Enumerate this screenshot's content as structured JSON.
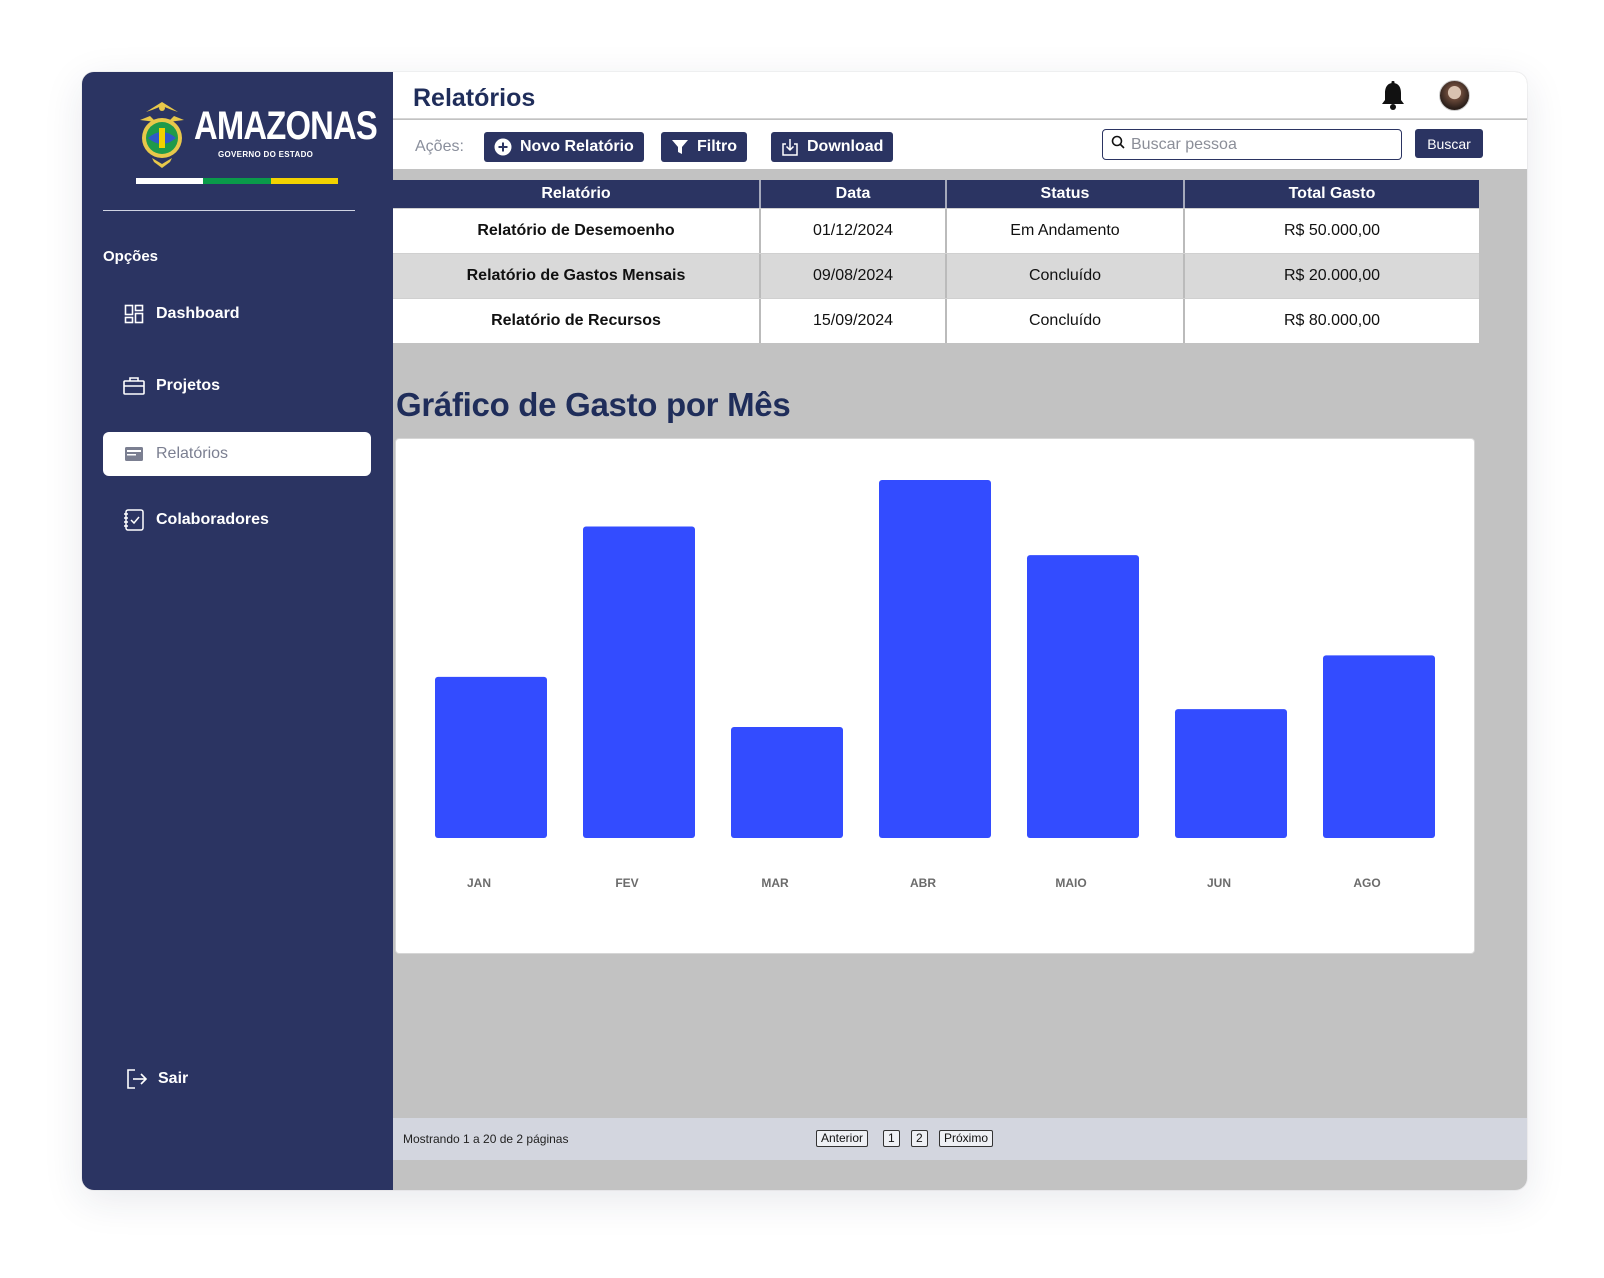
{
  "brand": {
    "title": "AMAZONAS",
    "subtitle": "GOVERNO DO ESTADO",
    "flag_colors": [
      "#ffffff",
      "#0a9a4a",
      "#f2d200"
    ]
  },
  "sidebar": {
    "section_label": "Opções",
    "items": [
      {
        "label": "Dashboard",
        "icon": "dashboard-icon"
      },
      {
        "label": "Projetos",
        "icon": "briefcase-icon"
      },
      {
        "label": "Relatórios",
        "icon": "report-icon",
        "active": true
      },
      {
        "label": "Colaboradores",
        "icon": "checklist-icon"
      }
    ],
    "logout_label": "Sair"
  },
  "header": {
    "title": "Relatórios",
    "notification_icon": "bell-icon",
    "avatar": "user-avatar"
  },
  "toolbar": {
    "actions_label": "Ações:",
    "new_report_label": "Novo Relatório",
    "filter_label": "Filtro",
    "download_label": "Download",
    "search_placeholder": "Buscar pessoa",
    "search_button_label": "Buscar"
  },
  "table": {
    "columns": [
      "Relatório",
      "Data",
      "Status",
      "Total Gasto"
    ],
    "rows": [
      [
        "Relatório de Desemoenho",
        "01/12/2024",
        "Em Andamento",
        "R$ 50.000,00"
      ],
      [
        "Relatório  de Gastos Mensais",
        "09/08/2024",
        "Concluído",
        "R$ 20.000,00"
      ],
      [
        "Relatório  de Recursos",
        "15/09/2024",
        "Concluído",
        "R$ 80.000,00"
      ]
    ]
  },
  "chart_title": "Gráfico de Gasto por Mês",
  "chart_data": {
    "type": "bar",
    "title": "Gráfico de Gasto por Mês",
    "categories": [
      "JAN",
      "FEV",
      "MAR",
      "ABR",
      "MAIO",
      "JUN",
      "AGO"
    ],
    "values": [
      45,
      87,
      31,
      100,
      79,
      36,
      51
    ],
    "ylim": [
      0,
      100
    ],
    "bar_color": "#334cff",
    "grid": false,
    "xlabel": "",
    "ylabel": ""
  },
  "pagination": {
    "info": "Mostrando 1 a 20 de 2 páginas",
    "prev_label": "Anterior",
    "pages": [
      "1",
      "2"
    ],
    "next_label": "Próximo"
  },
  "colors": {
    "navy": "#2b3462",
    "content_bg": "#c2c2c2",
    "accent_blue": "#334cff"
  }
}
